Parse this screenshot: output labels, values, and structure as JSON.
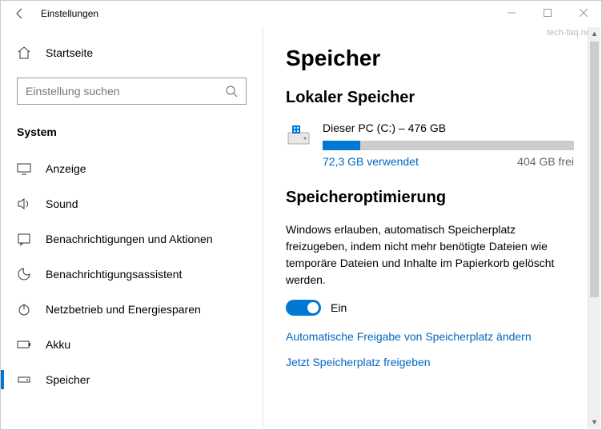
{
  "window": {
    "title": "Einstellungen",
    "watermark": "tech-faq.net"
  },
  "sidebar": {
    "home": "Startseite",
    "search_placeholder": "Einstellung suchen",
    "category": "System",
    "items": [
      {
        "label": "Anzeige"
      },
      {
        "label": "Sound"
      },
      {
        "label": "Benachrichtigungen und Aktionen"
      },
      {
        "label": "Benachrichtigungsassistent"
      },
      {
        "label": "Netzbetrieb und Energiesparen"
      },
      {
        "label": "Akku"
      },
      {
        "label": "Speicher"
      }
    ]
  },
  "content": {
    "title": "Speicher",
    "local_storage_heading": "Lokaler Speicher",
    "disk": {
      "name": "Dieser PC (C:) – 476 GB",
      "used": "72,3 GB verwendet",
      "free": "404 GB frei",
      "used_percent": 15
    },
    "storage_sense_heading": "Speicheroptimierung",
    "storage_sense_body": "Windows erlauben, automatisch Speicherplatz freizugeben, indem nicht mehr benötigte Dateien wie temporäre Dateien und Inhalte im Papierkorb gelöscht werden.",
    "toggle_state": "Ein",
    "link_change": "Automatische Freigabe von Speicherplatz ändern",
    "link_free_now": "Jetzt Speicherplatz freigeben"
  }
}
